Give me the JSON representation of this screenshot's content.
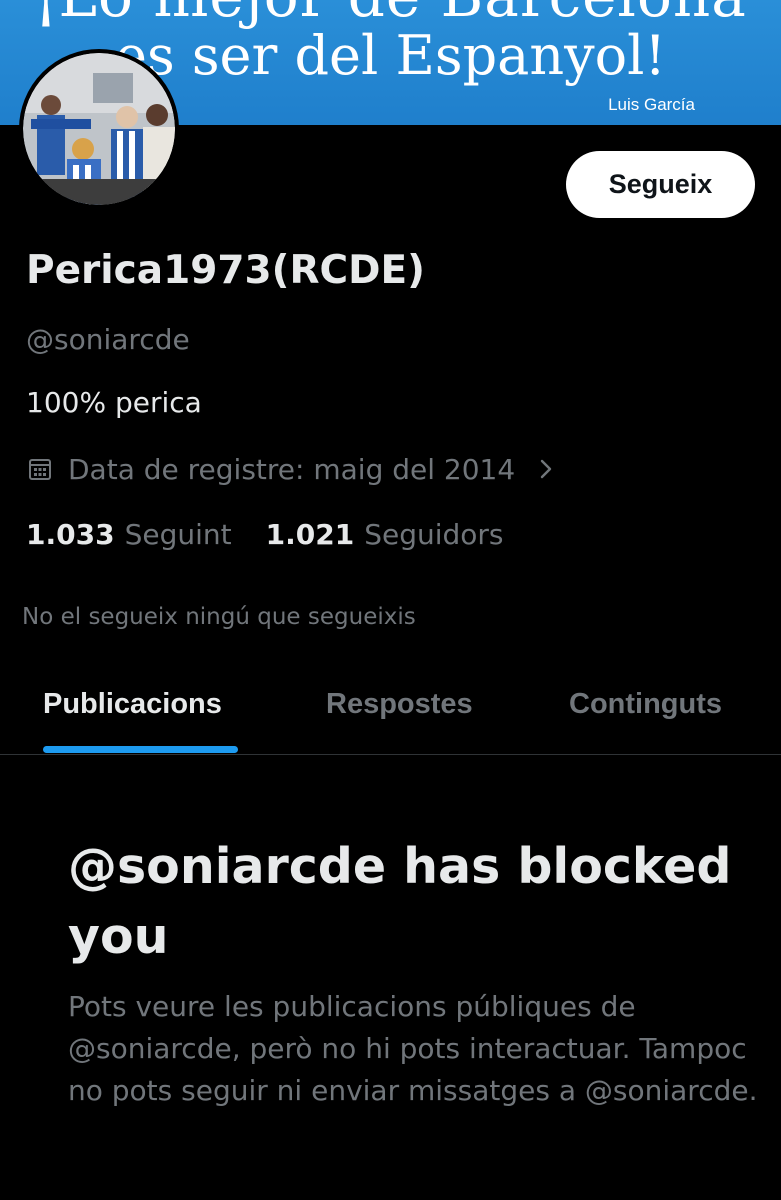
{
  "banner": {
    "line1": "¡Lo mejor de Barcelona",
    "line2": "es ser del Espanyol!",
    "author": "Luis García",
    "color": "#2a8fd8"
  },
  "profile": {
    "display_name": "Perica1973(RCDE)",
    "handle": "@soniarcde",
    "bio": "100% perica",
    "joined": "Data de registre: maig del 2014",
    "following_count": "1.033",
    "following_label": "Seguint",
    "followers_count": "1.021",
    "followers_label": "Seguidors",
    "followed_by_note": "No el segueix ningú que segueixis"
  },
  "actions": {
    "follow_label": "Segueix"
  },
  "tabs": [
    {
      "label": "Publicacions",
      "active": true
    },
    {
      "label": "Respostes",
      "active": false
    },
    {
      "label": "Continguts",
      "active": false
    }
  ],
  "blocked": {
    "title": "@soniarcde has blocked you",
    "body": "Pots veure les publicacions públiques de @soniarcde, però no hi pots interactuar. Tampoc no pots seguir ni enviar missatges a @soniarcde."
  },
  "icons": {
    "calendar": "calendar-icon",
    "chevron": "chevron-right-icon"
  },
  "colors": {
    "background": "#000000",
    "accent": "#1d9bf0",
    "text_primary": "#e7e9ea",
    "text_secondary": "#71767b"
  }
}
